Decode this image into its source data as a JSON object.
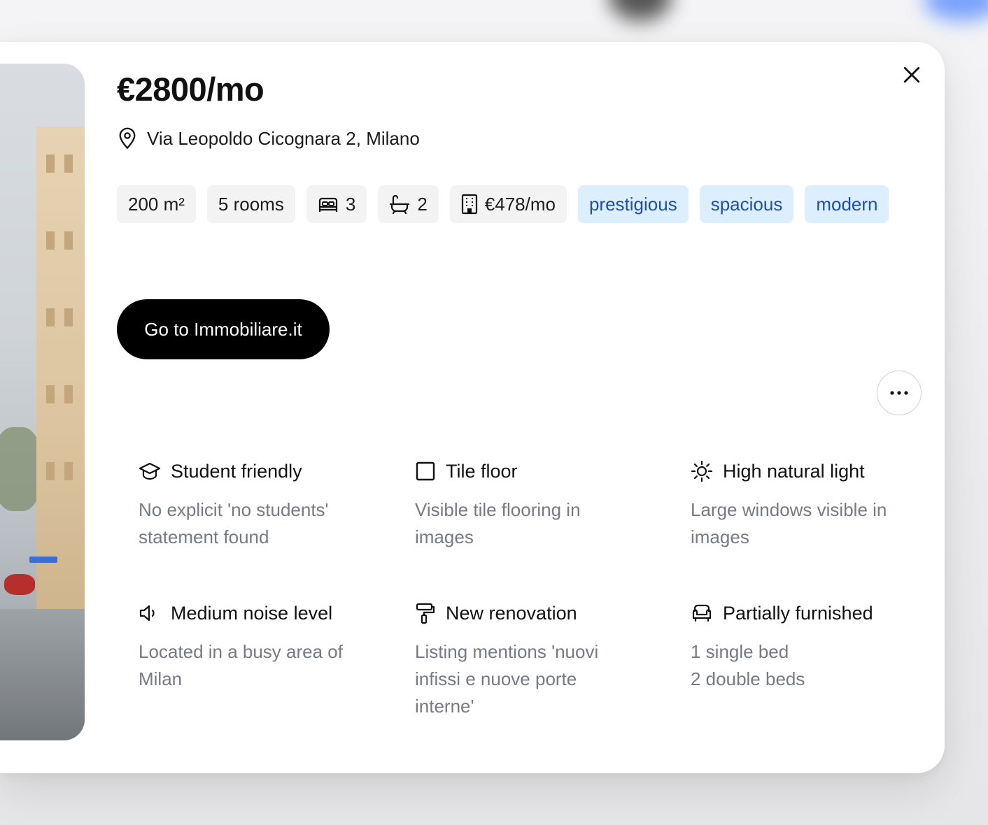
{
  "listing": {
    "price": "€2800/mo",
    "address": "Via Leopoldo Cicognara 2, Milano",
    "chips": {
      "area": "200 m²",
      "rooms": "5 rooms",
      "beds": "3",
      "baths": "2",
      "condo_fee": "€478/mo"
    },
    "tags": [
      "prestigious",
      "spacious",
      "modern"
    ],
    "cta_label": "Go to Immobiliare.it"
  },
  "features": [
    {
      "icon": "graduation-cap-icon",
      "title": "Student friendly",
      "desc": [
        "No explicit 'no students'",
        "statement found"
      ]
    },
    {
      "icon": "square-icon",
      "title": "Tile floor",
      "desc": [
        "Visible tile flooring in",
        "images"
      ]
    },
    {
      "icon": "sun-icon",
      "title": "High natural light",
      "desc": [
        "Large windows visible in",
        "images"
      ]
    },
    {
      "icon": "speaker-icon",
      "title": "Medium noise level",
      "desc": [
        "Located in a busy area of",
        "Milan"
      ]
    },
    {
      "icon": "paint-roller-icon",
      "title": "New renovation",
      "desc": [
        "Listing mentions 'nuovi",
        "infissi e nuove porte",
        "interne'"
      ]
    },
    {
      "icon": "armchair-icon",
      "title": "Partially furnished",
      "desc": [
        "1 single bed",
        "2 double beds"
      ]
    }
  ],
  "colors": {
    "tag_bg": "#ddeeff",
    "tag_text": "#1f4fa8",
    "chip_bg": "#f3f3f4",
    "cta_bg": "#000000",
    "desc_text": "#747b86"
  }
}
